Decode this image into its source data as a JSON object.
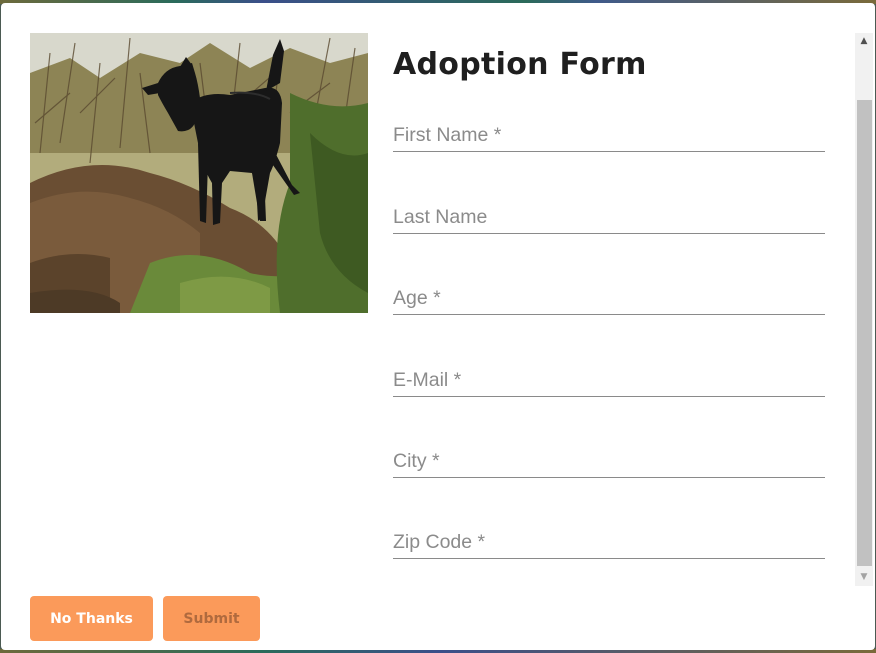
{
  "modal": {
    "photo_alt": "Black dog standing on a dirt mound"
  },
  "form": {
    "title": "Adoption Form",
    "fields": [
      {
        "placeholder": "First Name *",
        "value": ""
      },
      {
        "placeholder": "Last Name",
        "value": ""
      },
      {
        "placeholder": "Age *",
        "value": ""
      },
      {
        "placeholder": "E-Mail *",
        "value": ""
      },
      {
        "placeholder": "City *",
        "value": ""
      },
      {
        "placeholder": "Zip Code *",
        "value": ""
      }
    ]
  },
  "buttons": {
    "no_thanks": "No Thanks",
    "submit": "Submit"
  },
  "scrollbar": {
    "up_icon": "triangle-up",
    "down_icon": "triangle-down"
  },
  "colors": {
    "button_bg": "#fb9a5a",
    "title": "#1f1f1f",
    "field_underline": "#8a8a8a"
  }
}
